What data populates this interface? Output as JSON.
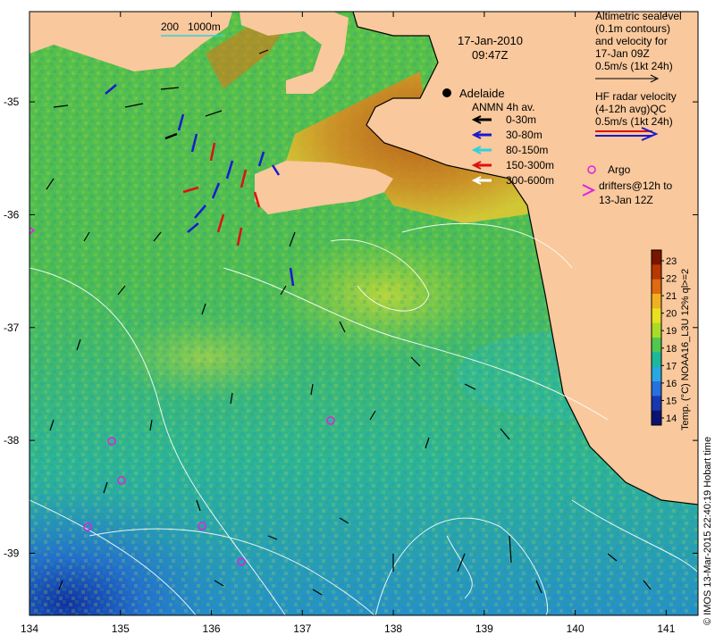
{
  "map": {
    "date": "17-Jan-2010",
    "time": "09:47Z",
    "scale_bar": {
      "label_200": "200",
      "label_1000": "1000m"
    },
    "city": "Adelaide",
    "x_ticks": [
      "134",
      "135",
      "136",
      "137",
      "138",
      "139",
      "140",
      "141"
    ],
    "y_ticks": [
      "-35",
      "-36",
      "-37",
      "-38",
      "-39"
    ],
    "extent": {
      "lon": [
        134,
        141.35
      ],
      "lat": [
        -39.55,
        -34.2
      ]
    }
  },
  "legend_anmn": {
    "title": "ANMN 4h av.",
    "items": [
      {
        "label": "0-30m",
        "color": "#000000"
      },
      {
        "label": "30-80m",
        "color": "#1a1acd"
      },
      {
        "label": "80-150m",
        "color": "#30d0e0"
      },
      {
        "label": "150-300m",
        "color": "#dd1111"
      },
      {
        "label": "300-600m",
        "color": "#ffffff"
      }
    ]
  },
  "legend_altimetry": {
    "lines": [
      "Altimetric sealevel",
      "(0.1m contours)",
      "and velocity for",
      "17-Jan 09Z",
      "0.5m/s (1kt 24h)"
    ]
  },
  "legend_hf": {
    "lines": [
      "HF radar velocity",
      "(4-12h avg)QC",
      "0.5m/s (1kt 24h)"
    ]
  },
  "legend_argo": {
    "lines": [
      "Argo",
      "drifters@12h to",
      "13-Jan 12Z"
    ],
    "color": "#e020e0"
  },
  "colorbar": {
    "ticks": [
      "23",
      "22",
      "21",
      "20",
      "19",
      "18",
      "17",
      "16",
      "15",
      "14"
    ],
    "title": "Temp. (°C) NOAA16_L3U 12% ql>=2",
    "colors": [
      "#7a1500",
      "#b83800",
      "#e06a10",
      "#f0b020",
      "#e8e020",
      "#a8dc28",
      "#50c850",
      "#1cb89a",
      "#28a8e0",
      "#2870e0",
      "#1838b0",
      "#0a1470"
    ]
  },
  "credit": "© IMOS 13-Mar-2015 22:40:19 Hobart time",
  "colors": {
    "land": "#f9c89c",
    "coast": "#000000"
  }
}
